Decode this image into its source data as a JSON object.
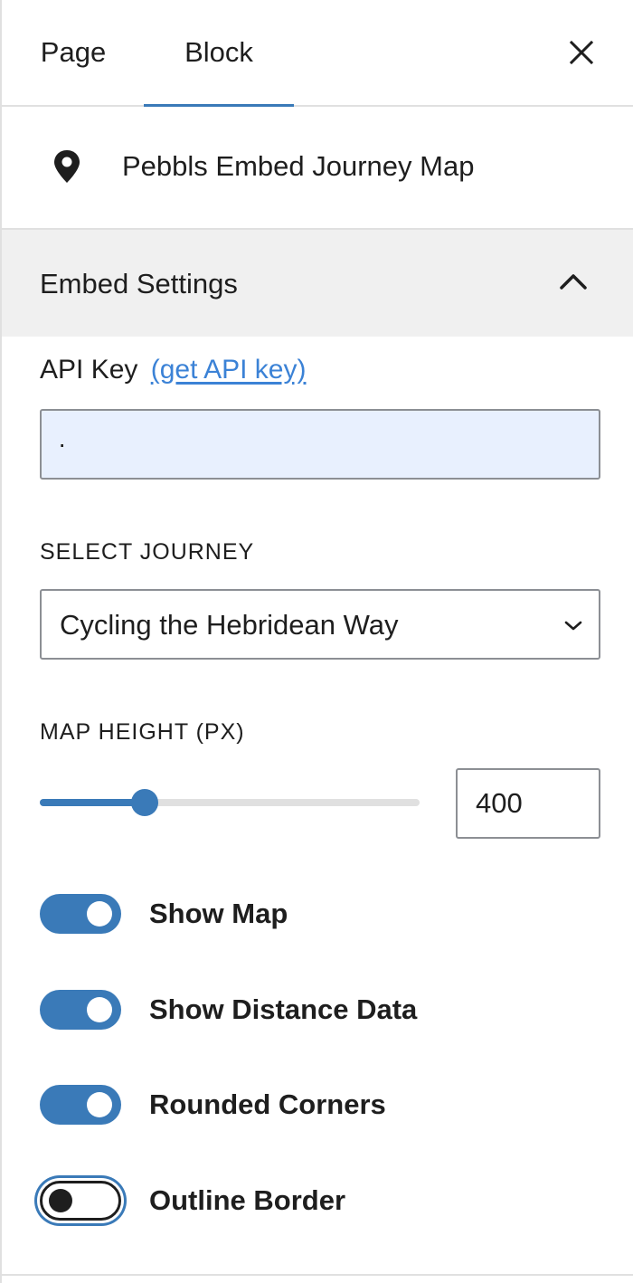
{
  "tabs": {
    "page_label": "Page",
    "block_label": "Block",
    "active": "Block"
  },
  "block": {
    "icon": "map-pin-icon",
    "title": "Pebbls Embed Journey Map"
  },
  "embed_settings": {
    "title": "Embed Settings",
    "expanded": true,
    "api_key": {
      "label": "API Key",
      "link_text": "(get API key)",
      "value": "·",
      "background_color": "#e8f0fe"
    },
    "journey": {
      "label": "SELECT JOURNEY",
      "selected": "Cycling the Hebridean Way"
    },
    "map_height": {
      "label": "MAP HEIGHT (PX)",
      "value": "400",
      "slider_fraction": 0.276
    },
    "toggles": [
      {
        "label": "Show Map",
        "on": true
      },
      {
        "label": "Show Distance Data",
        "on": true
      },
      {
        "label": "Rounded Corners",
        "on": true
      },
      {
        "label": "Outline Border",
        "on": false,
        "focused": true
      }
    ]
  },
  "colors": {
    "accent": "#3a7ab8",
    "link": "#3b82d6",
    "text": "#1e1e1e",
    "section_bg": "#f0f0f0",
    "border": "#e0e0e0"
  }
}
